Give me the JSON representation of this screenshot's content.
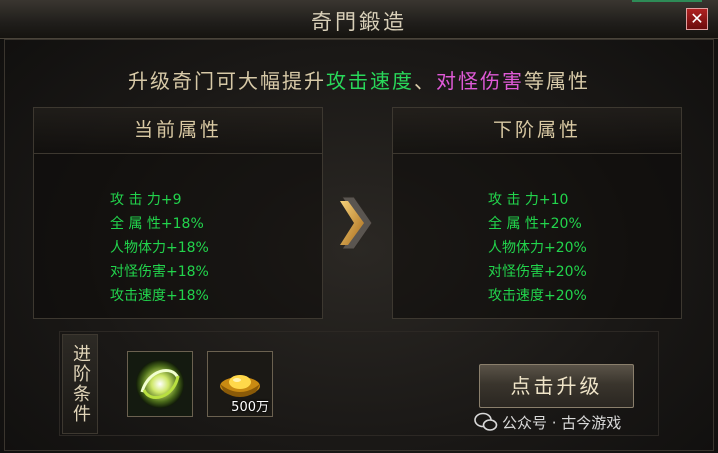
{
  "window": {
    "title": "奇門鍛造",
    "close_symbol": "✕"
  },
  "headline": {
    "part1": "升级奇门可大幅提升",
    "part2": "攻击速度",
    "sep": "、",
    "part3": "对怪伤害",
    "part4": "等属性"
  },
  "current": {
    "header": "当前属性",
    "attrs": [
      "攻 击 力+9",
      "全 属 性+18%",
      "人物体力+18%",
      "对怪伤害+18%",
      "攻击速度+18%"
    ]
  },
  "next": {
    "header": "下阶属性",
    "attrs": [
      "攻 击 力+10",
      "全 属 性+20%",
      "人物体力+20%",
      "对怪伤害+20%",
      "攻击速度+20%"
    ]
  },
  "conditions": {
    "label": "进阶条件",
    "items": [
      {
        "icon": "swirl-orb-icon",
        "count": ""
      },
      {
        "icon": "gold-ingot-icon",
        "count": "500万"
      }
    ]
  },
  "upgrade_button": "点击升级",
  "watermark": "公众号 · 古今游戏",
  "colors": {
    "attr_green": "#22d44c",
    "highlight_green": "#29d85a",
    "highlight_pink": "#e05ad8",
    "text_gold": "#d9c9a3"
  }
}
